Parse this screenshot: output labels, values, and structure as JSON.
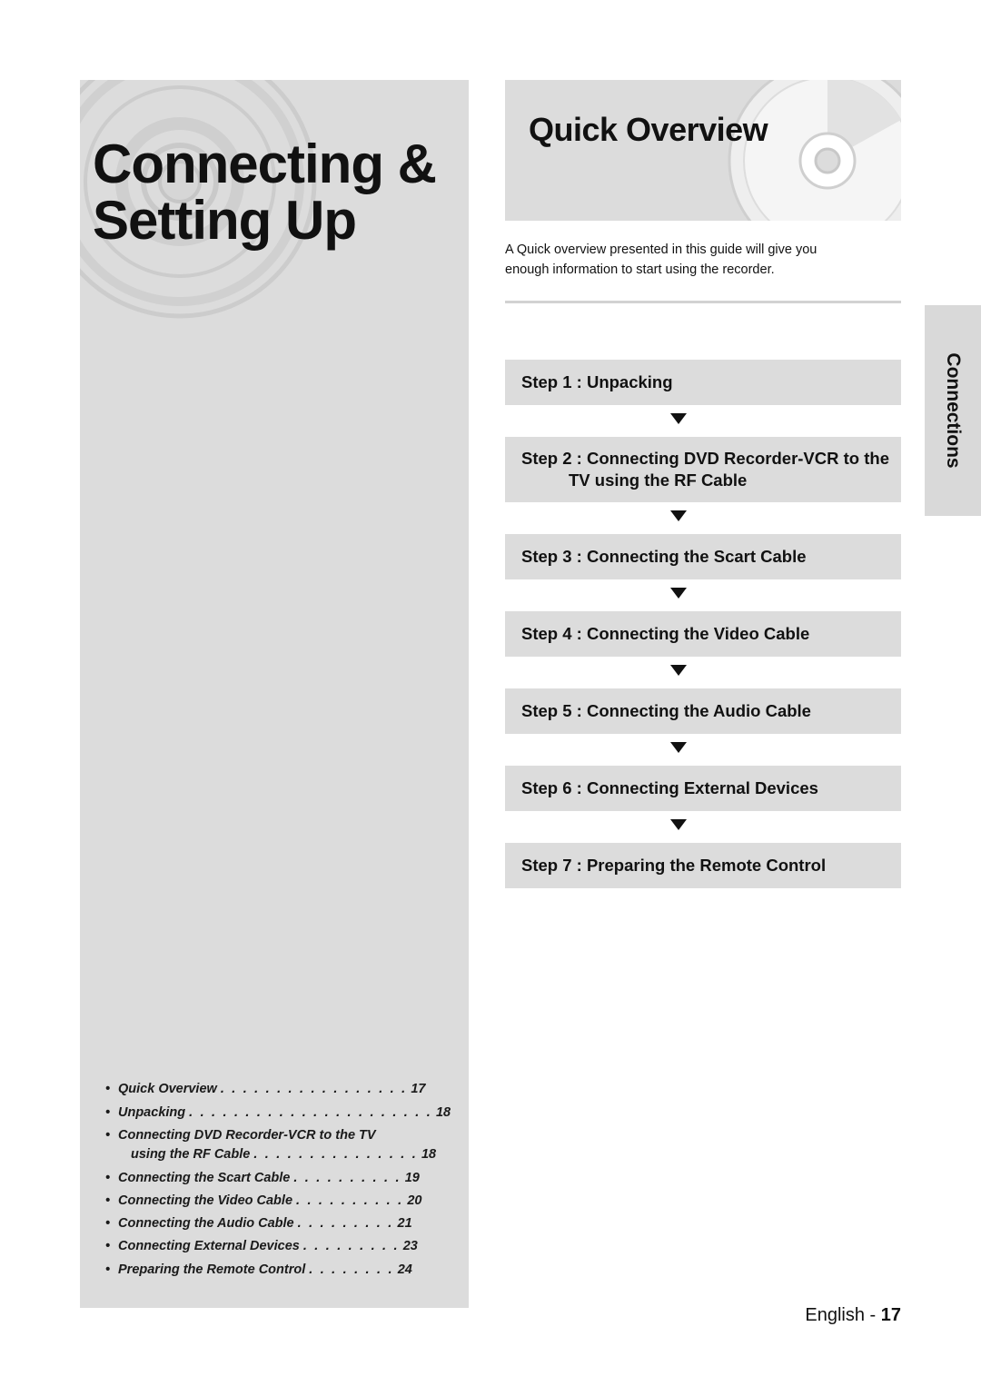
{
  "hero": {
    "line1": "Connecting &",
    "line2": "Setting Up"
  },
  "banner": {
    "title": "Quick Overview"
  },
  "intro": {
    "line1": "A Quick overview presented in this guide will give you",
    "line2": "enough information to start using the recorder."
  },
  "steps": [
    {
      "label": "Step 1 : Unpacking",
      "lines": [
        "Step 1 : Unpacking"
      ]
    },
    {
      "label": "Step 2 : Connecting DVD Recorder-VCR to the TV using the RF Cable",
      "lines": [
        "Step 2 : Connecting DVD Recorder-VCR to the",
        "TV using the RF Cable"
      ]
    },
    {
      "label": "Step 3 : Connecting the Scart Cable",
      "lines": [
        "Step 3 : Connecting the Scart Cable"
      ]
    },
    {
      "label": "Step 4 : Connecting the Video Cable",
      "lines": [
        "Step 4 : Connecting the Video Cable"
      ]
    },
    {
      "label": "Step 5 : Connecting the Audio Cable",
      "lines": [
        "Step 5 : Connecting the Audio Cable"
      ]
    },
    {
      "label": "Step 6 : Connecting External Devices",
      "lines": [
        "Step 6 : Connecting External Devices"
      ]
    },
    {
      "label": "Step 7 : Preparing the Remote Control",
      "lines": [
        "Step 7 : Preparing the Remote Control"
      ]
    }
  ],
  "toc": [
    {
      "bullet": "•",
      "label": "Quick Overview",
      "dots": ". . . . . . . . . . . . . . . . .",
      "page": "17"
    },
    {
      "bullet": "•",
      "label": "Unpacking",
      "dots": ". . . . . . . . . . . . . . . . . . . . . .",
      "page": "18"
    },
    {
      "bullet": "•",
      "label": "Connecting DVD Recorder-VCR to the TV",
      "sub": "using the RF Cable",
      "dots": ". . . . . . . . . . . . . . .",
      "page": "18"
    },
    {
      "bullet": "•",
      "label": "Connecting the Scart Cable",
      "dots": ". . . . . . . . . .",
      "page": "19"
    },
    {
      "bullet": "•",
      "label": "Connecting the Video Cable",
      "dots": ". . . . . . . . . .",
      "page": "20"
    },
    {
      "bullet": "•",
      "label": "Connecting the Audio Cable",
      "dots": ". . . . . . . . .",
      "page": "21"
    },
    {
      "bullet": "•",
      "label": "Connecting External Devices",
      "dots": ". . . . . . . . .",
      "page": "23"
    },
    {
      "bullet": "•",
      "label": "Preparing the Remote Control",
      "dots": ". . . . . . . .",
      "page": "24"
    }
  ],
  "side_tab": {
    "label": "Connections"
  },
  "footer": {
    "language": "English -",
    "page": "17"
  },
  "icons": {
    "arrow_down": "down-arrow-icon",
    "disc": "disc-icon"
  },
  "colors": {
    "panel_gray": "#dcdcdc",
    "tab_gray": "#d9d9d9",
    "text": "#111111"
  }
}
